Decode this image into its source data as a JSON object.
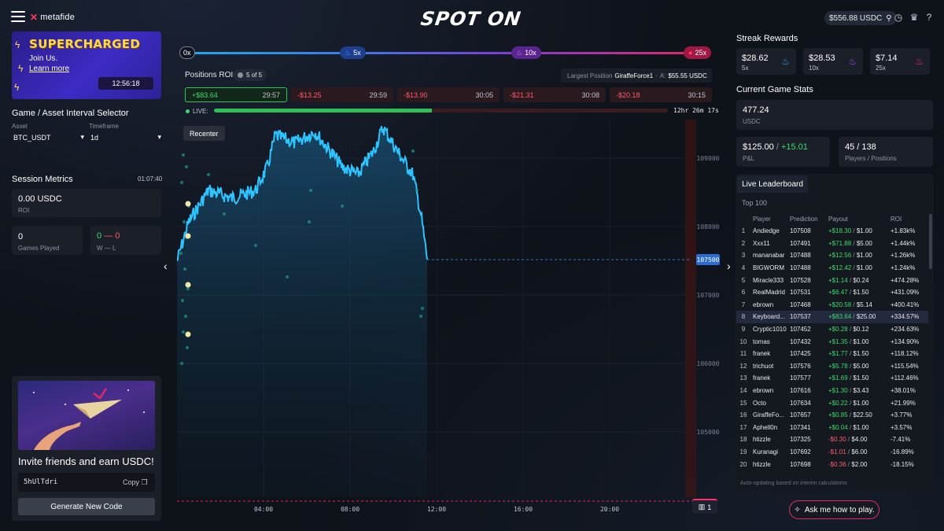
{
  "header": {
    "brand": "metafide",
    "logo": "SPOT ON",
    "balance": "$556.88 USDC"
  },
  "promo": {
    "title": "SUPERCHARGED",
    "subtitle": "Join Us.",
    "link": "Learn more",
    "timer": "12:56:18"
  },
  "selector": {
    "title": "Game / Asset Interval Selector",
    "asset_label": "Asset",
    "asset_value": "BTC_USDT",
    "timeframe_label": "Timeframe",
    "timeframe_value": "1d"
  },
  "session": {
    "title": "Session Metrics",
    "time": "01:07:40",
    "roi_value": "0.00 USDC",
    "roi_label": "ROI",
    "games_value": "0",
    "games_label": "Games Played",
    "wins": "0",
    "dash": "—",
    "losses": "0",
    "wl_label": "W — L"
  },
  "invite": {
    "title": "Invite friends and earn USDC!",
    "code": "5hUlTdri",
    "copy": "Copy",
    "generate": "Generate New Code"
  },
  "multipliers": {
    "m0": "0x",
    "m5": "5x",
    "m10": "10x",
    "m25": "25x"
  },
  "positions": {
    "title": "Positions ROI",
    "count": "5 of 5",
    "largest_label": "Largest Position",
    "largest_player": "GiraffeForce1",
    "largest_sep": "·",
    "largest_prefix": "A:",
    "largest_amount": "$55.55 USDC",
    "items": [
      {
        "roi": "+$83.64",
        "time": "29:57",
        "win": true
      },
      {
        "roi": "-$13.25",
        "time": "29:59",
        "win": false
      },
      {
        "roi": "-$13.90",
        "time": "30:05",
        "win": false
      },
      {
        "roi": "-$21.31",
        "time": "30:08",
        "win": false
      },
      {
        "roi": "-$20.18",
        "time": "30:15",
        "win": false
      }
    ]
  },
  "live": {
    "label": "LIVE:",
    "progress": 0.48,
    "countdown": "12hr 26m 17s"
  },
  "chart": {
    "recenter": "Recenter",
    "current_price": "107500",
    "badge_count": "1"
  },
  "chart_data": {
    "type": "line",
    "y_ticks": [
      "109000",
      "108000",
      "107000",
      "106000",
      "105000"
    ],
    "x_ticks": [
      "04:00",
      "08:00",
      "12:00",
      "16:00",
      "20:00"
    ],
    "ylim": [
      104000,
      109500
    ],
    "current": 107500
  },
  "streak": {
    "title": "Streak Rewards",
    "items": [
      {
        "value": "$28.62",
        "mult": "5x",
        "color": "#3aa3ff"
      },
      {
        "value": "$28.53",
        "mult": "10x",
        "color": "#a44bff"
      },
      {
        "value": "$7.14",
        "mult": "25x",
        "color": "#ff3355"
      }
    ]
  },
  "game_stats": {
    "title": "Current Game Stats",
    "pool_value": "477.24",
    "pool_label": "USDC",
    "pnl_value": "$125.00",
    "pnl_sep": "/",
    "pnl_change": "+15.01",
    "pnl_label": "P&L",
    "players_value": "45 / 138",
    "players_label": "Players / Positions"
  },
  "leaderboard": {
    "tab": "Live Leaderboard",
    "subtitle": "Top 100",
    "headers": [
      "Player",
      "Prediction",
      "Payout",
      "ROI"
    ],
    "footer": "Auto-updating based on interim calculations",
    "rows": [
      {
        "n": "1",
        "player": "Andiedge",
        "pred": "107508",
        "pay": "+$18.30",
        "stake": "$1.00",
        "roi": "+1.83k%",
        "pos": true
      },
      {
        "n": "2",
        "player": "Xxx11",
        "pred": "107491",
        "pay": "+$71.88",
        "stake": "$5.00",
        "roi": "+1.44k%",
        "pos": true
      },
      {
        "n": "3",
        "player": "mananabar",
        "pred": "107488",
        "pay": "+$12.56",
        "stake": "$1.00",
        "roi": "+1.26k%",
        "pos": true
      },
      {
        "n": "4",
        "player": "BIGWORM",
        "pred": "107488",
        "pay": "+$12.42",
        "stake": "$1.00",
        "roi": "+1.24k%",
        "pos": true
      },
      {
        "n": "5",
        "player": "Miracle333",
        "pred": "107528",
        "pay": "+$1.14",
        "stake": "$0.24",
        "roi": "+474.28%",
        "pos": true
      },
      {
        "n": "6",
        "player": "RealMadrid",
        "pred": "107531",
        "pay": "+$6.47",
        "stake": "$1.50",
        "roi": "+431.09%",
        "pos": true
      },
      {
        "n": "7",
        "player": "ebrown",
        "pred": "107468",
        "pay": "+$20.58",
        "stake": "$5.14",
        "roi": "+400.41%",
        "pos": true
      },
      {
        "n": "8",
        "player": "Keyboard...",
        "pred": "107537",
        "pay": "+$83.64",
        "stake": "$25.00",
        "roi": "+334.57%",
        "pos": true,
        "hl": true
      },
      {
        "n": "9",
        "player": "Cryptic1010",
        "pred": "107452",
        "pay": "+$0.28",
        "stake": "$0.12",
        "roi": "+234.63%",
        "pos": true
      },
      {
        "n": "10",
        "player": "tomas",
        "pred": "107432",
        "pay": "+$1.35",
        "stake": "$1.00",
        "roi": "+134.90%",
        "pos": true
      },
      {
        "n": "11",
        "player": "franek",
        "pred": "107425",
        "pay": "+$1.77",
        "stake": "$1.50",
        "roi": "+118.12%",
        "pos": true
      },
      {
        "n": "12",
        "player": "trichuot",
        "pred": "107576",
        "pay": "+$5.78",
        "stake": "$5.00",
        "roi": "+115.54%",
        "pos": true
      },
      {
        "n": "13",
        "player": "franek",
        "pred": "107577",
        "pay": "+$1.69",
        "stake": "$1.50",
        "roi": "+112.46%",
        "pos": true
      },
      {
        "n": "14",
        "player": "ebrown",
        "pred": "107616",
        "pay": "+$1.30",
        "stake": "$3.43",
        "roi": "+38.01%",
        "pos": true
      },
      {
        "n": "15",
        "player": "Octo",
        "pred": "107634",
        "pay": "+$0.22",
        "stake": "$1.00",
        "roi": "+21.99%",
        "pos": true
      },
      {
        "n": "16",
        "player": "GiraffeFo...",
        "pred": "107657",
        "pay": "+$0.85",
        "stake": "$22.50",
        "roi": "+3.77%",
        "pos": true
      },
      {
        "n": "17",
        "player": "Aphell0n",
        "pred": "107341",
        "pay": "+$0.04",
        "stake": "$1.00",
        "roi": "+3.57%",
        "pos": true
      },
      {
        "n": "18",
        "player": "htizzle",
        "pred": "107325",
        "pay": "-$0.30",
        "stake": "$4.00",
        "roi": "-7.41%",
        "pos": false
      },
      {
        "n": "19",
        "player": "Kuranagi",
        "pred": "107692",
        "pay": "-$1.01",
        "stake": "$6.00",
        "roi": "-16.89%",
        "pos": false
      },
      {
        "n": "20",
        "player": "htizzle",
        "pred": "107698",
        "pay": "-$0.36",
        "stake": "$2.00",
        "roi": "-18.15%",
        "pos": false
      }
    ]
  },
  "help": {
    "ask": "Ask me how to play."
  }
}
